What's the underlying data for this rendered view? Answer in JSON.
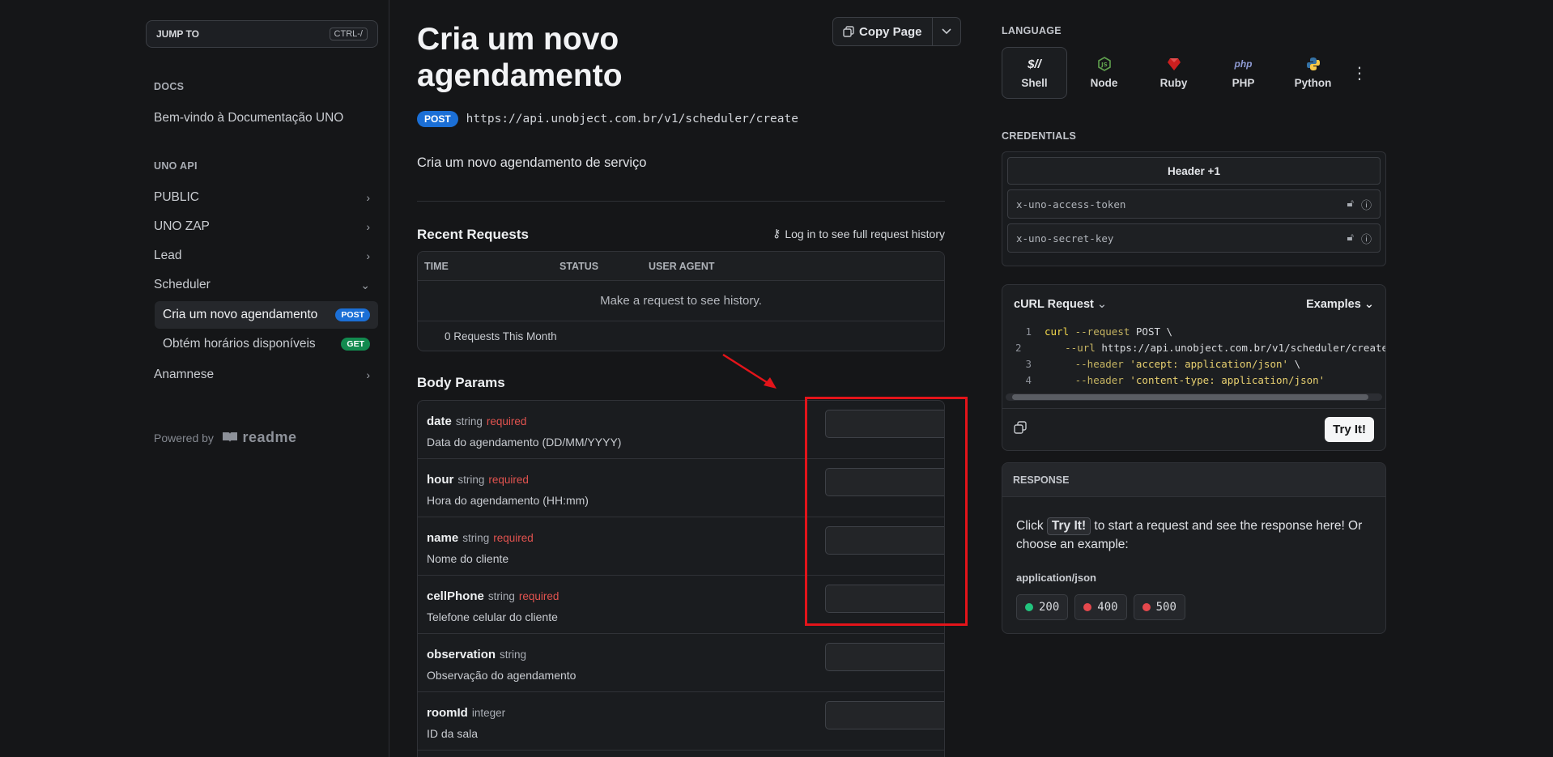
{
  "sidebar": {
    "jump_to": "JUMP TO",
    "shortcut": "CTRL-/",
    "docs_heading": "DOCS",
    "docs_items": [
      "Bem-vindo à Documentação UNO"
    ],
    "api_heading": "UNO API",
    "api_items": [
      "PUBLIC",
      "UNO ZAP",
      "Lead",
      "Scheduler"
    ],
    "scheduler_items": [
      {
        "label": "Cria um novo agendamento",
        "method": "POST"
      },
      {
        "label": "Obtém horários disponíveis",
        "method": "GET"
      }
    ],
    "anamnese": "Anamnese",
    "powered_by": "Powered by",
    "readme_logo": "readme"
  },
  "main": {
    "title": "Cria um novo agendamento",
    "copy_page": "Copy Page",
    "method": "POST",
    "url": "https://api.unobject.com.br/v1/scheduler/create",
    "description": "Cria um novo agendamento de serviço",
    "recent_requests": {
      "title": "Recent Requests",
      "login_link": "Log in to see full request history",
      "columns": [
        "TIME",
        "STATUS",
        "USER AGENT"
      ],
      "empty": "Make a request to see history.",
      "footer": "0 Requests This Month"
    },
    "body_params": {
      "title": "Body Params",
      "params": [
        {
          "name": "date",
          "type": "string",
          "required": "required",
          "description": "Data do agendamento (DD/MM/YYYY)",
          "value": ""
        },
        {
          "name": "hour",
          "type": "string",
          "required": "required",
          "description": "Hora do agendamento (HH:mm)",
          "value": ""
        },
        {
          "name": "name",
          "type": "string",
          "required": "required",
          "description": "Nome do cliente",
          "value": ""
        },
        {
          "name": "cellPhone",
          "type": "string",
          "required": "required",
          "description": "Telefone celular do cliente",
          "value": ""
        },
        {
          "name": "observation",
          "type": "string",
          "required": "",
          "description": "Observação do agendamento",
          "value": ""
        },
        {
          "name": "roomId",
          "type": "integer",
          "required": "",
          "description": "ID da sala",
          "value": ""
        }
      ]
    }
  },
  "right": {
    "language_label": "LANGUAGE",
    "languages": [
      "Shell",
      "Node",
      "Ruby",
      "PHP",
      "Python"
    ],
    "active_language": "Shell",
    "credentials_label": "CREDENTIALS",
    "credentials_header": "Header +1",
    "credential_fields": [
      "x-uno-access-token",
      "x-uno-secret-key"
    ],
    "curl_title": "cURL Request",
    "examples": "Examples",
    "code_lines": [
      {
        "n": "1",
        "parts": [
          [
            "kw",
            "curl"
          ],
          [
            "fl",
            " --request"
          ],
          [
            "tx",
            " POST \\"
          ]
        ]
      },
      {
        "n": "2",
        "parts": [
          [
            "fl",
            "     --url"
          ],
          [
            "tx",
            " https://api.unobject.com.br/v1/scheduler/create"
          ]
        ]
      },
      {
        "n": "3",
        "parts": [
          [
            "fl",
            "     --header"
          ],
          [
            "st",
            " 'accept: application/json'"
          ],
          [
            "tx",
            " \\"
          ]
        ]
      },
      {
        "n": "4",
        "parts": [
          [
            "fl",
            "     --header"
          ],
          [
            "st",
            " 'content-type: application/json'"
          ]
        ]
      }
    ],
    "try_it": "Try It!",
    "response_label": "RESPONSE",
    "response_text_before": "Click",
    "response_text_btn": "Try It!",
    "response_text_after": "to start a request and see the response here! Or choose an example:",
    "response_type": "application/json",
    "status_codes": [
      {
        "code": "200",
        "color": "#22c47e"
      },
      {
        "code": "400",
        "color": "#e5484d"
      },
      {
        "code": "500",
        "color": "#e5484d"
      }
    ]
  }
}
